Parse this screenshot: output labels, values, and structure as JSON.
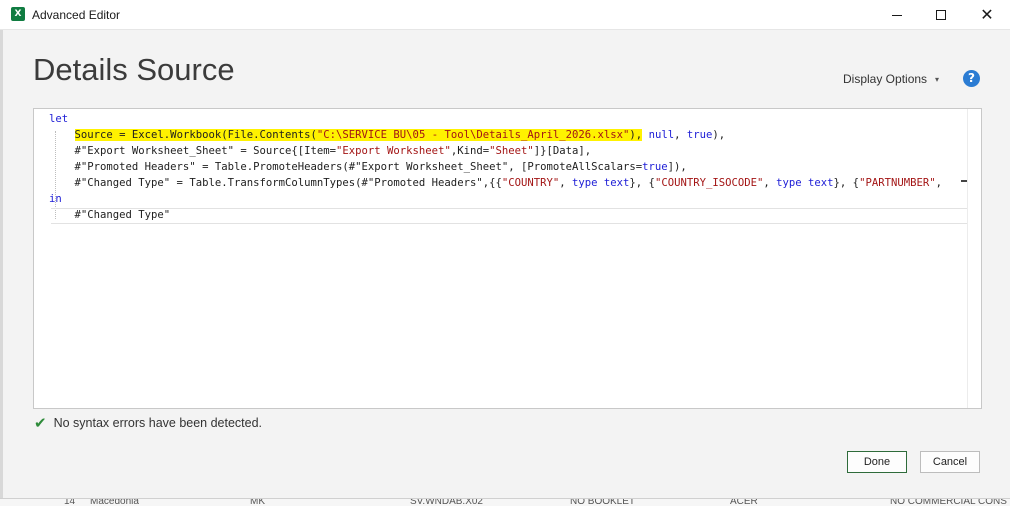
{
  "window": {
    "title": "Advanced Editor",
    "app_icon_letter": "X",
    "minimize_glyph": "",
    "close_glyph": "✕"
  },
  "header": {
    "title": "Details Source",
    "display_options": "Display Options",
    "display_options_chevron": "▾",
    "help_glyph": "?"
  },
  "editor": {
    "lines": [
      {
        "segments": [
          {
            "t": "let",
            "c": "kw"
          }
        ]
      },
      {
        "segments": [
          {
            "t": "    ",
            "c": ""
          },
          {
            "t": "Source = Excel.Workbook(File.Contents(",
            "c": "hl"
          },
          {
            "t": "\"C:\\SERVICE BU\\05 - Tool\\Details_April_2026.xlsx\"",
            "c": "hl str"
          },
          {
            "t": "),",
            "c": "hl"
          },
          {
            "t": " ",
            "c": ""
          },
          {
            "t": "null",
            "c": "kw"
          },
          {
            "t": ", ",
            "c": ""
          },
          {
            "t": "true",
            "c": "kw"
          },
          {
            "t": "),",
            "c": ""
          }
        ]
      },
      {
        "segments": [
          {
            "t": "    #\"Export Worksheet_Sheet\" = Source{[Item=",
            "c": ""
          },
          {
            "t": "\"Export Worksheet\"",
            "c": "str"
          },
          {
            "t": ",Kind=",
            "c": ""
          },
          {
            "t": "\"Sheet\"",
            "c": "str"
          },
          {
            "t": "]}[Data],",
            "c": ""
          }
        ]
      },
      {
        "segments": [
          {
            "t": "    #\"Promoted Headers\" = Table.PromoteHeaders(#\"Export Worksheet_Sheet\", [PromoteAllScalars=",
            "c": ""
          },
          {
            "t": "true",
            "c": "kw"
          },
          {
            "t": "]),",
            "c": ""
          }
        ]
      },
      {
        "segments": [
          {
            "t": "    #\"Changed Type\" = Table.TransformColumnTypes(#\"Promoted Headers\",{{",
            "c": ""
          },
          {
            "t": "\"COUNTRY\"",
            "c": "str"
          },
          {
            "t": ", ",
            "c": ""
          },
          {
            "t": "type text",
            "c": "kw"
          },
          {
            "t": "}, {",
            "c": ""
          },
          {
            "t": "\"COUNTRY_ISOCODE\"",
            "c": "str"
          },
          {
            "t": ", ",
            "c": ""
          },
          {
            "t": "type text",
            "c": "kw"
          },
          {
            "t": "}, {",
            "c": ""
          },
          {
            "t": "\"PARTNUMBER\"",
            "c": "str"
          },
          {
            "t": ",",
            "c": ""
          }
        ]
      },
      {
        "segments": [
          {
            "t": "in",
            "c": "kw"
          }
        ]
      },
      {
        "segments": [
          {
            "t": "    #\"Changed Type\"",
            "c": ""
          }
        ]
      }
    ]
  },
  "status": {
    "check_glyph": "✔",
    "message": "No syntax errors have been detected."
  },
  "buttons": {
    "done": "Done",
    "cancel": "Cancel"
  },
  "background_row": {
    "cells": [
      "14",
      "Macedonia",
      "MK",
      "SV.WNDAB.X02",
      "NO BOOKLET",
      "ACER",
      "NO COMMERCIAL CONS"
    ]
  }
}
